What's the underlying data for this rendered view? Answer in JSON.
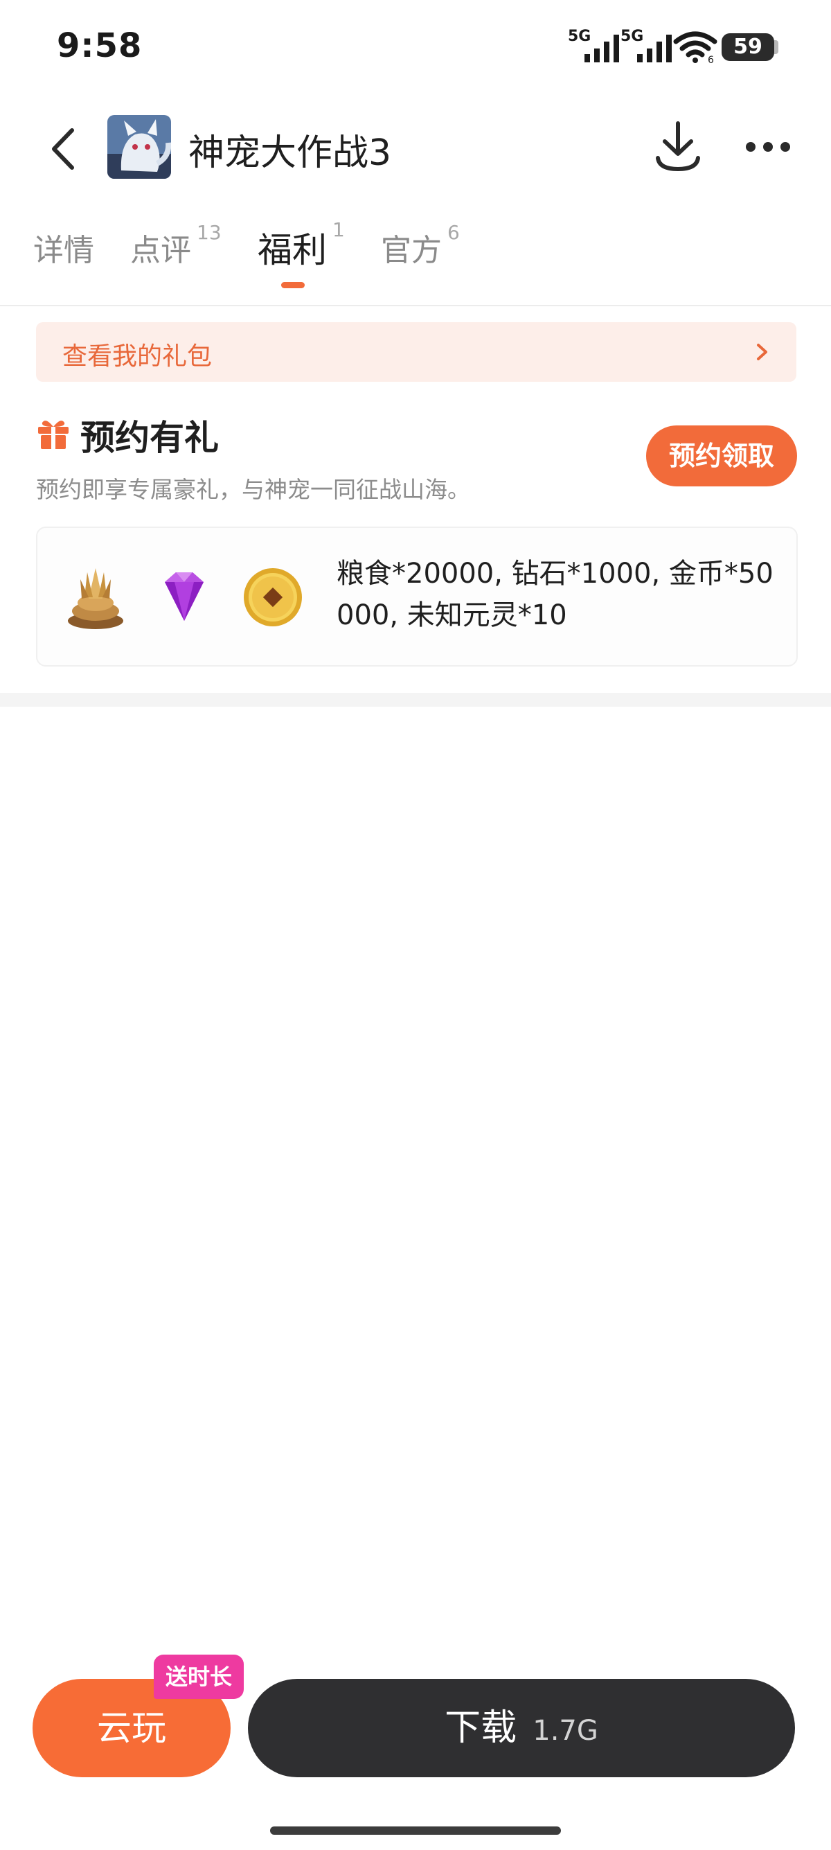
{
  "status_bar": {
    "time": "9:58",
    "signal_1_label": "5G",
    "signal_2_label": "5G",
    "wifi_label": "6",
    "battery": "59",
    "icons": [
      "signal-icon",
      "signal-icon",
      "wifi-icon",
      "battery-icon"
    ]
  },
  "header": {
    "title": "神宠大作战3",
    "icons": [
      "back-icon",
      "app-icon",
      "download-icon",
      "more-icon"
    ]
  },
  "tabs": [
    {
      "label": "详情",
      "count": ""
    },
    {
      "label": "点评",
      "count": "13"
    },
    {
      "label": "福利",
      "count": "1",
      "active": true
    },
    {
      "label": "官方",
      "count": "6"
    }
  ],
  "my_gifts": {
    "label": "查看我的礼包"
  },
  "reserve": {
    "title": "预约有礼",
    "subtitle": "预约即享专属豪礼，与神宠一同征战山海。",
    "button_label": "预约领取",
    "rewards_text": "粮食*20000, 钻石*1000, 金币*50000, 未知元灵*10",
    "reward_icons": [
      "grain-icon",
      "diamond-icon",
      "gold-coin-icon"
    ]
  },
  "bottom_bar": {
    "cloud_play_label": "云玩",
    "bonus_badge": "送时长",
    "download_label": "下载",
    "download_size": "1.7G"
  },
  "colors": {
    "accent": "#f26b3a",
    "badge": "#ee3aa0",
    "download_button": "#2f2f31",
    "my_gifts_bg": "#fdeee9"
  }
}
